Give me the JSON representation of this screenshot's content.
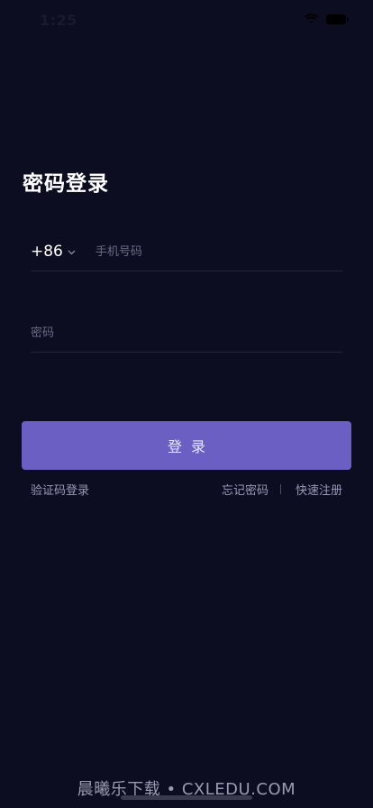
{
  "status_bar": {
    "time": "1:25",
    "wifi_icon": "wifi-icon",
    "battery_icon": "battery-icon"
  },
  "title": "密码登录",
  "phone": {
    "country_code": "+86",
    "chevron_icon": "chevron-down-icon",
    "placeholder": "手机号码",
    "value": ""
  },
  "password": {
    "placeholder": "密码",
    "value": ""
  },
  "login_button_label": "登录",
  "links": {
    "sms_login": "验证码登录",
    "forgot_password": "忘记密码",
    "quick_register": "快速注册"
  },
  "watermark": "晨曦乐下载 • CXLEDU.COM",
  "colors": {
    "background": "#0d0d22",
    "accent": "#6b5fc4",
    "link_text": "#9a9ab8"
  }
}
